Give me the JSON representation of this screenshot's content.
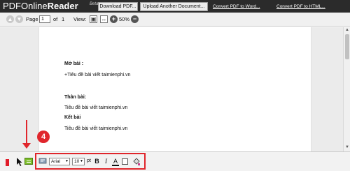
{
  "header": {
    "logo_prefix": "PDFOnline",
    "logo_bold": "Reader",
    "logo_beta": "Beta",
    "buttons": {
      "download": "Download PDF...",
      "upload": "Upload Another Document..."
    },
    "links": {
      "convert_word": "Convert PDF to Word...",
      "convert_html": "Convert PDF to HTML..."
    }
  },
  "toolbar": {
    "page_label": "Page",
    "page_value": "1",
    "of_label": "of",
    "total_pages": "1",
    "view_label": "View:",
    "zoom_percent": "50%"
  },
  "document": {
    "lines": [
      "Mở bài :",
      "+Tiêu đề bài viết taimienphi.vn",
      "Thân bài:",
      "Tiêu đề bài viết taimienphi.vn",
      "Kết bài",
      "Tiêu đề bài viết taimienphi.vn"
    ]
  },
  "format_toolbar": {
    "font_value": "Arial",
    "size_value": "10",
    "pt_label": "pt",
    "bold_label": "B",
    "italic_label": "I",
    "color_label": "A"
  },
  "annotation": {
    "step_badge": "4",
    "color": "#e0262c"
  },
  "colors": {
    "header_bg": "#2b2b2b",
    "note_icon": "#7cbd2a",
    "bookmark_icon": "#e11d2a"
  }
}
